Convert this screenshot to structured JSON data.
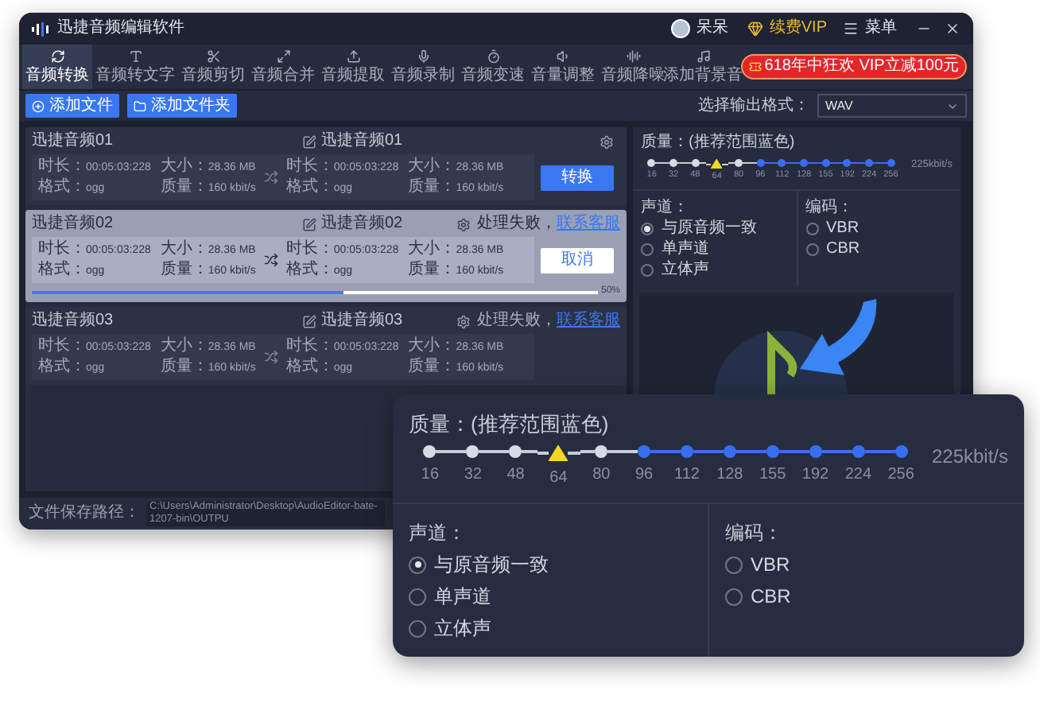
{
  "window": {
    "title": "迅捷音频编辑软件",
    "user": "呆呆",
    "vip": "续费VIP",
    "menu": "菜单"
  },
  "tabs": [
    {
      "label": "音频转换",
      "selected": true
    },
    {
      "label": "音频转文字",
      "selected": false
    },
    {
      "label": "音频剪切",
      "selected": false
    },
    {
      "label": "音频合并",
      "selected": false
    },
    {
      "label": "音频提取",
      "selected": false
    },
    {
      "label": "音频录制",
      "selected": false
    },
    {
      "label": "音频变速",
      "selected": false
    },
    {
      "label": "音量调整",
      "selected": false
    },
    {
      "label": "音频降噪",
      "selected": false
    },
    {
      "label": "添加背景音",
      "selected": false
    }
  ],
  "promo": "618年中狂欢 VIP立减100元",
  "actions": [
    "添加文件",
    "添加文件夹"
  ],
  "output_format": {
    "label": "选择输出格式：",
    "value": "WAV"
  },
  "files": [
    {
      "name": "迅捷音频01",
      "output_name": "迅捷音频01",
      "selected": false,
      "source": [
        {
          "label": "时长：",
          "value": "00:05:03:228"
        },
        {
          "label": "大小：",
          "value": "28.36 MB"
        },
        {
          "label": "格式：",
          "value": "ogg"
        },
        {
          "label": "质量：",
          "value": "160 kbit/s"
        }
      ],
      "output": [
        {
          "label": "时长：",
          "value": "00:05:03:228"
        },
        {
          "label": "大小：",
          "value": "28.36 MB"
        },
        {
          "label": "格式：",
          "value": "ogg"
        },
        {
          "label": "质量：",
          "value": "160 kbit/s"
        }
      ],
      "button": {
        "label": "转换",
        "kind": "primary"
      }
    },
    {
      "name": "迅捷音频02",
      "output_name": "迅捷音频02",
      "selected": true,
      "status": "处理失败，",
      "link": "联系客服",
      "source": [
        {
          "label": "时长：",
          "value": "00:05:03:228"
        },
        {
          "label": "大小：",
          "value": "28.36 MB"
        },
        {
          "label": "格式：",
          "value": "ogg"
        },
        {
          "label": "质量：",
          "value": "160 kbit/s"
        }
      ],
      "output": [
        {
          "label": "时长：",
          "value": "00:05:03:228"
        },
        {
          "label": "大小：",
          "value": "28.36 MB"
        },
        {
          "label": "格式：",
          "value": "ogg"
        },
        {
          "label": "质量：",
          "value": "160 kbit/s"
        }
      ],
      "button": {
        "label": "取消",
        "kind": "secondary"
      },
      "level": 0.55,
      "progress": "50%"
    },
    {
      "name": "迅捷音频03",
      "output_name": "迅捷音频03",
      "selected": false,
      "status": "处理失败，",
      "link": "联系客服",
      "source": [
        {
          "label": "时长：",
          "value": "00:05:03:228"
        },
        {
          "label": "大小：",
          "value": "28.36 MB"
        },
        {
          "label": "格式：",
          "value": "ogg"
        },
        {
          "label": "质量：",
          "value": "160 kbit/s"
        }
      ],
      "output": [
        {
          "label": "时长：",
          "value": "00:05:03:228"
        },
        {
          "label": "大小：",
          "value": "28.36 MB"
        },
        {
          "label": "格式：",
          "value": "ogg"
        },
        {
          "label": "质量：",
          "value": "160 kbit/s"
        }
      ]
    }
  ],
  "save_path": {
    "label": "文件保存路径：",
    "value": "C:\\Users\\Administrator\\Desktop\\AudioEditor-bate-1207-bin\\OUTPU"
  },
  "settings_panel": {
    "quality_label": "质量：(推荐范围蓝色)",
    "reading": "225kbit/s",
    "ticks": [
      {
        "label": "16",
        "recommended": false,
        "selected": false
      },
      {
        "label": "32",
        "recommended": false,
        "selected": false
      },
      {
        "label": "48",
        "recommended": false,
        "selected": false
      },
      {
        "label": "64",
        "recommended": false,
        "selected": true
      },
      {
        "label": "80",
        "recommended": false,
        "selected": false
      },
      {
        "label": "96",
        "recommended": true,
        "selected": false
      },
      {
        "label": "112",
        "recommended": true,
        "selected": false
      },
      {
        "label": "128",
        "recommended": true,
        "selected": false
      },
      {
        "label": "155",
        "recommended": true,
        "selected": false
      },
      {
        "label": "192",
        "recommended": true,
        "selected": false
      },
      {
        "label": "224",
        "recommended": true,
        "selected": false
      },
      {
        "label": "256",
        "recommended": true,
        "selected": false
      }
    ],
    "channel": {
      "label": "声道：",
      "options": [
        {
          "label": "与原音频一致",
          "selected": true
        },
        {
          "label": "单声道",
          "selected": false
        },
        {
          "label": "立体声",
          "selected": false
        }
      ]
    },
    "encoding": {
      "label": "编码：",
      "options": [
        {
          "label": "VBR",
          "selected": false
        },
        {
          "label": "CBR",
          "selected": false
        }
      ]
    }
  },
  "settings_popup": {
    "quality_label": "质量：(推荐范围蓝色)",
    "reading": "225kbit/s",
    "ticks": [
      {
        "label": "16",
        "recommended": false,
        "selected": false
      },
      {
        "label": "32",
        "recommended": false,
        "selected": false
      },
      {
        "label": "48",
        "recommended": false,
        "selected": false
      },
      {
        "label": "64",
        "recommended": false,
        "selected": true
      },
      {
        "label": "80",
        "recommended": false,
        "selected": false
      },
      {
        "label": "96",
        "recommended": true,
        "selected": false
      },
      {
        "label": "112",
        "recommended": true,
        "selected": false
      },
      {
        "label": "128",
        "recommended": true,
        "selected": false
      },
      {
        "label": "155",
        "recommended": true,
        "selected": false
      },
      {
        "label": "192",
        "recommended": true,
        "selected": false
      },
      {
        "label": "224",
        "recommended": true,
        "selected": false
      },
      {
        "label": "256",
        "recommended": true,
        "selected": false
      }
    ],
    "channel": {
      "label": "声道：",
      "options": [
        {
          "label": "与原音频一致",
          "selected": true
        },
        {
          "label": "单声道",
          "selected": false
        },
        {
          "label": "立体声",
          "selected": false
        }
      ]
    },
    "encoding": {
      "label": "编码：",
      "options": [
        {
          "label": "VBR",
          "selected": false
        },
        {
          "label": "CBR",
          "selected": false
        }
      ]
    }
  }
}
